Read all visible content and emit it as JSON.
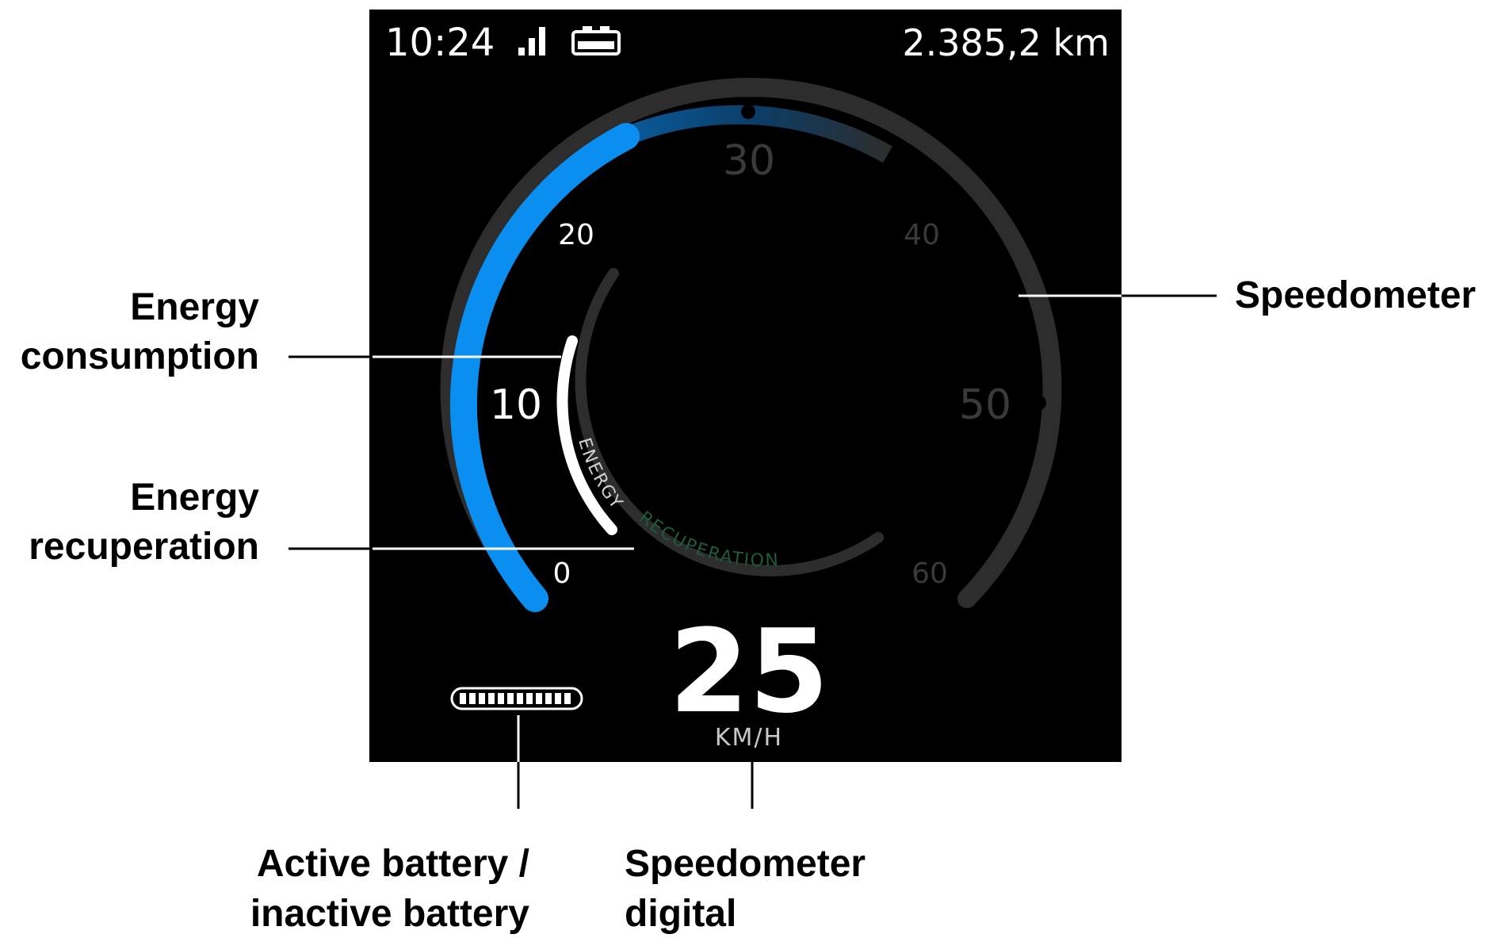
{
  "display": {
    "time": "10:24",
    "odometer": "2.385,2 km",
    "speed_value": "25",
    "speed_unit": "KM/H",
    "arc_label_energy": "ENERGY",
    "arc_label_recuperation": "RECUPERATION",
    "icons": [
      "signal-icon",
      "battery-icon",
      "battery-bar-icon"
    ]
  },
  "speedometer": {
    "ticks": [
      "0",
      "10",
      "20",
      "30",
      "40",
      "50",
      "60"
    ],
    "min": 0,
    "max": 60,
    "current_speed": 25,
    "active_color": "#0a8ff0",
    "track_color": "#2d2d2d",
    "screen_color": "#000000"
  },
  "energy": {
    "consumption_level": 0.35,
    "consumption_color": "#ffffff",
    "recuperation_color": "#1c5c3c"
  },
  "callouts": {
    "energy_consumption": [
      "Energy",
      "consumption"
    ],
    "energy_recuperation": [
      "Energy",
      "recuperation"
    ],
    "speedometer": "Speedometer",
    "battery": [
      "Active battery /",
      "inactive battery"
    ],
    "speedometer_digital": [
      "Speedometer",
      "digital"
    ]
  }
}
